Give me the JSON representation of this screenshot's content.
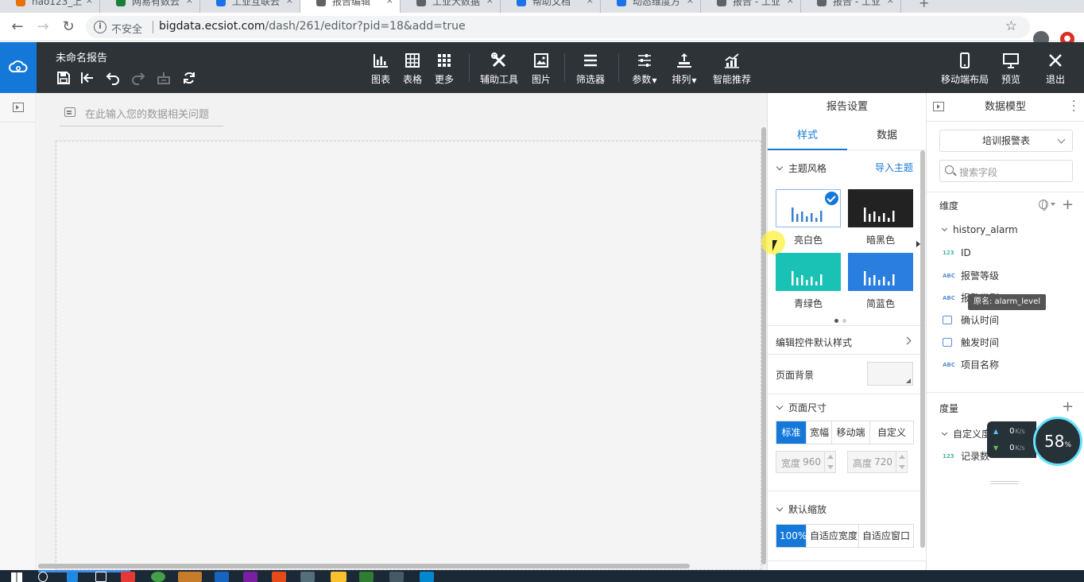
{
  "browser": {
    "tabs": [
      {
        "label": "hao123_上"
      },
      {
        "label": "网易有数云"
      },
      {
        "label": "工业互联云"
      },
      {
        "label": "报告编辑"
      },
      {
        "label": "工业大数据"
      },
      {
        "label": "帮助文档"
      },
      {
        "label": "动态维度方"
      },
      {
        "label": "报告 - 工业"
      },
      {
        "label": "报告 - 工业"
      }
    ],
    "security_label": "不安全",
    "url_host": "bigdata.ecsiot.com",
    "url_path": "/dash/261/editor?pid=18&add=true"
  },
  "toolbar": {
    "report_title": "未命名报告",
    "tools": {
      "chart": "图表",
      "table": "表格",
      "more": "更多",
      "aux_tools": "辅助工具",
      "image": "图片",
      "filter": "筛选器",
      "params": "参数",
      "sort": "排列",
      "smart": "智能推荐",
      "mobile_layout": "移动端布局",
      "preview": "预览",
      "exit": "退出"
    }
  },
  "canvas": {
    "ask_placeholder": "在此输入您的数据相关问题"
  },
  "settings": {
    "title": "报告设置",
    "tab_style": "样式",
    "tab_data": "数据",
    "theme_section": "主题风格",
    "import_theme": "导入主题",
    "themes": [
      {
        "name": "亮白色",
        "color": "#ffffff",
        "bar": "#3a7fd6",
        "selected": true
      },
      {
        "name": "暗黑色",
        "color": "#222222",
        "bar": "#ffffff",
        "selected": false
      },
      {
        "name": "青绿色",
        "color": "#19c2b4",
        "bar": "#ffffff",
        "selected": false
      },
      {
        "name": "简蓝色",
        "color": "#2a7ee0",
        "bar": "#ffffff",
        "selected": false
      }
    ],
    "control_style": "编辑控件默认样式",
    "page_background": "页面背景",
    "page_size_section": "页面尺寸",
    "size_options": [
      "标准",
      "宽幅",
      "移动端",
      "自定义"
    ],
    "size_selected": "标准",
    "width_label": "宽度",
    "width_value": "960",
    "height_label": "高度",
    "height_value": "720",
    "zoom_section": "默认缩放",
    "zoom_options": [
      "100%",
      "自适应宽度",
      "自适应窗口"
    ],
    "zoom_selected": "100%"
  },
  "model": {
    "title": "数据模型",
    "dataset": "培训报警表",
    "search_placeholder": "搜索字段",
    "dimension_label": "维度",
    "table_name": "history_alarm",
    "dimensions": [
      {
        "type": "123",
        "name": "ID"
      },
      {
        "type": "ABC",
        "name": "报警等级"
      },
      {
        "type": "ABC",
        "name": "报警类型"
      },
      {
        "type": "cal",
        "name": "确认时间"
      },
      {
        "type": "cal",
        "name": "触发时间"
      },
      {
        "type": "ABC",
        "name": "项目名称"
      }
    ],
    "tooltip": "原名: alarm_level",
    "measure_label": "度量",
    "measure_group": "自定义度",
    "measures": [
      {
        "type": "123",
        "name": "记录数"
      }
    ]
  },
  "net_widget": {
    "up": "0",
    "down": "0",
    "unit": "K/s",
    "cpu": "58",
    "cpu_unit": "%"
  },
  "colors": {
    "accent": "#1478d9",
    "toolbar_bg": "#2e3338"
  }
}
